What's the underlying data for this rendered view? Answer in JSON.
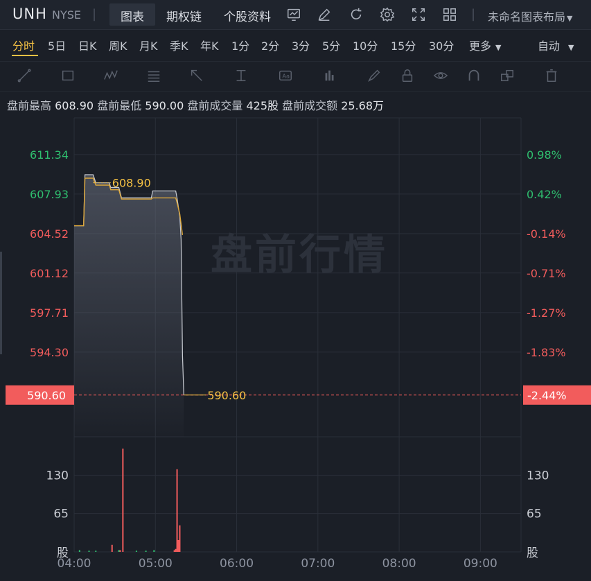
{
  "header": {
    "symbol": "UNH",
    "exchange": "NYSE",
    "tabs": [
      "图表",
      "期权链",
      "个股资料"
    ],
    "active_tab": "图表",
    "icons": [
      "indicator-icon",
      "draw-icon",
      "refresh-icon",
      "settings-icon",
      "fullscreen-icon",
      "layout-grid-icon"
    ],
    "layout_label": "未命名图表布局"
  },
  "periods": {
    "items": [
      "分时",
      "5日",
      "日K",
      "周K",
      "月K",
      "季K",
      "年K",
      "1分",
      "2分",
      "3分",
      "5分",
      "10分",
      "15分",
      "30分",
      "更多"
    ],
    "active": "分时",
    "mode": "自动"
  },
  "toolbar": {
    "tools": [
      "trend-line-icon",
      "rectangle-icon",
      "wave-icon",
      "fib-icon",
      "arrow-icon",
      "measure-icon",
      "text-icon",
      "bars-icon",
      "brush-icon",
      "lock-icon",
      "eye-icon",
      "magnet-icon",
      "layers-icon",
      "trash-icon"
    ]
  },
  "stats": {
    "high_label": "盘前最高",
    "high": "608.90",
    "low_label": "盘前最低",
    "low": "590.00",
    "volume_label": "盘前成交量",
    "volume": "425股",
    "turnover_label": "盘前成交额",
    "turnover": "25.68万"
  },
  "chart_data": {
    "type": "line",
    "watermark": "盘前行情",
    "price_axis": {
      "left_ticks": [
        "611.34",
        "607.93",
        "604.52",
        "601.12",
        "597.71",
        "594.30"
      ],
      "right_ticks": [
        "0.98%",
        "0.42%",
        "-0.14%",
        "-0.71%",
        "-1.27%",
        "-1.83%"
      ],
      "ylim": [
        587.0,
        614.5
      ]
    },
    "current_price": "590.60",
    "current_change": "-2.44%",
    "max_label": "608.90",
    "time_ticks": [
      "04:00",
      "05:00",
      "06:00",
      "07:00",
      "08:00",
      "09:00"
    ],
    "volume_axis": {
      "ticks": [
        "130",
        "65"
      ],
      "unit": "股",
      "ylim": [
        0,
        195
      ]
    },
    "price_series": [
      {
        "t": 0,
        "p": 605.2
      },
      {
        "t": 7,
        "p": 605.2
      },
      {
        "t": 8,
        "p": 609.6
      },
      {
        "t": 14,
        "p": 609.6
      },
      {
        "t": 16,
        "p": 608.9
      },
      {
        "t": 26,
        "p": 608.9
      },
      {
        "t": 27,
        "p": 608.5
      },
      {
        "t": 33,
        "p": 608.5
      },
      {
        "t": 35,
        "p": 607.6
      },
      {
        "t": 50,
        "p": 607.6
      },
      {
        "t": 51,
        "p": 607.6
      },
      {
        "t": 57,
        "p": 607.6
      },
      {
        "t": 58,
        "p": 608.2
      },
      {
        "t": 75,
        "p": 608.2
      },
      {
        "t": 76,
        "p": 607.6
      },
      {
        "t": 78,
        "p": 606.0
      },
      {
        "t": 79,
        "p": 604.0
      },
      {
        "t": 80,
        "p": 594.0
      },
      {
        "t": 81,
        "p": 590.6
      }
    ],
    "avg_series": [
      {
        "t": 0,
        "p": 605.2
      },
      {
        "t": 7,
        "p": 605.2
      },
      {
        "t": 8,
        "p": 609.3
      },
      {
        "t": 14,
        "p": 609.3
      },
      {
        "t": 16,
        "p": 608.7
      },
      {
        "t": 26,
        "p": 608.7
      },
      {
        "t": 27,
        "p": 608.3
      },
      {
        "t": 33,
        "p": 608.3
      },
      {
        "t": 35,
        "p": 607.5
      },
      {
        "t": 57,
        "p": 607.5
      },
      {
        "t": 58,
        "p": 607.6
      },
      {
        "t": 75,
        "p": 607.6
      },
      {
        "t": 76,
        "p": 607.2
      },
      {
        "t": 78,
        "p": 606.2
      },
      {
        "t": 80,
        "p": 604.4
      }
    ],
    "volume_bars": [
      {
        "t": 4,
        "v": 3,
        "color": "green"
      },
      {
        "t": 11,
        "v": 2,
        "color": "green"
      },
      {
        "t": 16,
        "v": 2,
        "color": "green"
      },
      {
        "t": 28,
        "v": 12,
        "color": "red"
      },
      {
        "t": 33,
        "v": 3,
        "color": "green"
      },
      {
        "t": 34,
        "v": 3,
        "color": "red"
      },
      {
        "t": 36,
        "v": 175,
        "color": "red"
      },
      {
        "t": 46,
        "v": 2,
        "color": "green"
      },
      {
        "t": 53,
        "v": 2,
        "color": "green"
      },
      {
        "t": 59,
        "v": 3,
        "color": "green"
      },
      {
        "t": 74,
        "v": 3,
        "color": "red"
      },
      {
        "t": 75,
        "v": 5,
        "color": "red"
      },
      {
        "t": 76,
        "v": 140,
        "color": "red"
      },
      {
        "t": 77,
        "v": 20,
        "color": "red"
      },
      {
        "t": 78,
        "v": 45,
        "color": "red"
      }
    ],
    "colors": {
      "up": "#2fbf6f",
      "down": "#f25c5c",
      "price_line": "#c9ccd3",
      "avg_line": "#e0a93a",
      "current": "#f25c5c",
      "highlight": "#f6c244"
    }
  }
}
